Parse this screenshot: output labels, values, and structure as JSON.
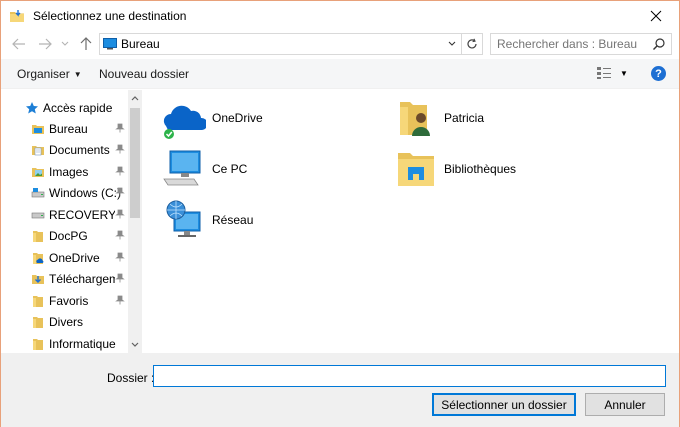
{
  "window": {
    "title": "Sélectionnez une destination",
    "accent_border": "#e8a17a"
  },
  "nav": {
    "back_icon": "arrow-left-icon",
    "forward_icon": "arrow-right-icon",
    "recent_icon": "chevron-down-icon",
    "up_icon": "arrow-up-icon",
    "address_text": "Bureau",
    "search_placeholder": "Rechercher dans : Bureau"
  },
  "toolbar": {
    "organize_label": "Organiser",
    "new_folder_label": "Nouveau dossier",
    "help_label": "?"
  },
  "sidebar": {
    "items": [
      {
        "label": "Accès rapide",
        "icon": "star-icon",
        "pinned": false
      },
      {
        "label": "Bureau",
        "icon": "desktop-folder-icon",
        "pinned": true
      },
      {
        "label": "Documents",
        "icon": "documents-folder-icon",
        "pinned": true
      },
      {
        "label": "Images",
        "icon": "pictures-folder-icon",
        "pinned": true
      },
      {
        "label": "Windows (C:)",
        "icon": "drive-icon",
        "pinned": true
      },
      {
        "label": "RECOVERY (D",
        "icon": "drive-icon",
        "pinned": true
      },
      {
        "label": "DocPG",
        "icon": "folder-icon",
        "pinned": true
      },
      {
        "label": "OneDrive",
        "icon": "onedrive-folder-icon",
        "pinned": true
      },
      {
        "label": "Téléchargeme",
        "icon": "downloads-folder-icon",
        "pinned": true
      },
      {
        "label": "Favoris",
        "icon": "folder-icon",
        "pinned": true
      },
      {
        "label": "Divers",
        "icon": "folder-icon",
        "pinned": false
      },
      {
        "label": "Informatique",
        "icon": "folder-icon",
        "pinned": false
      }
    ]
  },
  "content": {
    "tiles": [
      {
        "label": "OneDrive",
        "icon": "onedrive-cloud-icon"
      },
      {
        "label": "Patricia",
        "icon": "user-folder-icon"
      },
      {
        "label": "Ce PC",
        "icon": "computer-icon"
      },
      {
        "label": "Bibliothèques",
        "icon": "libraries-icon"
      },
      {
        "label": "Réseau",
        "icon": "network-icon"
      }
    ]
  },
  "footer": {
    "folder_label": "Dossier :",
    "folder_value": "",
    "select_button": "Sélectionner un dossier",
    "cancel_button": "Annuler"
  }
}
